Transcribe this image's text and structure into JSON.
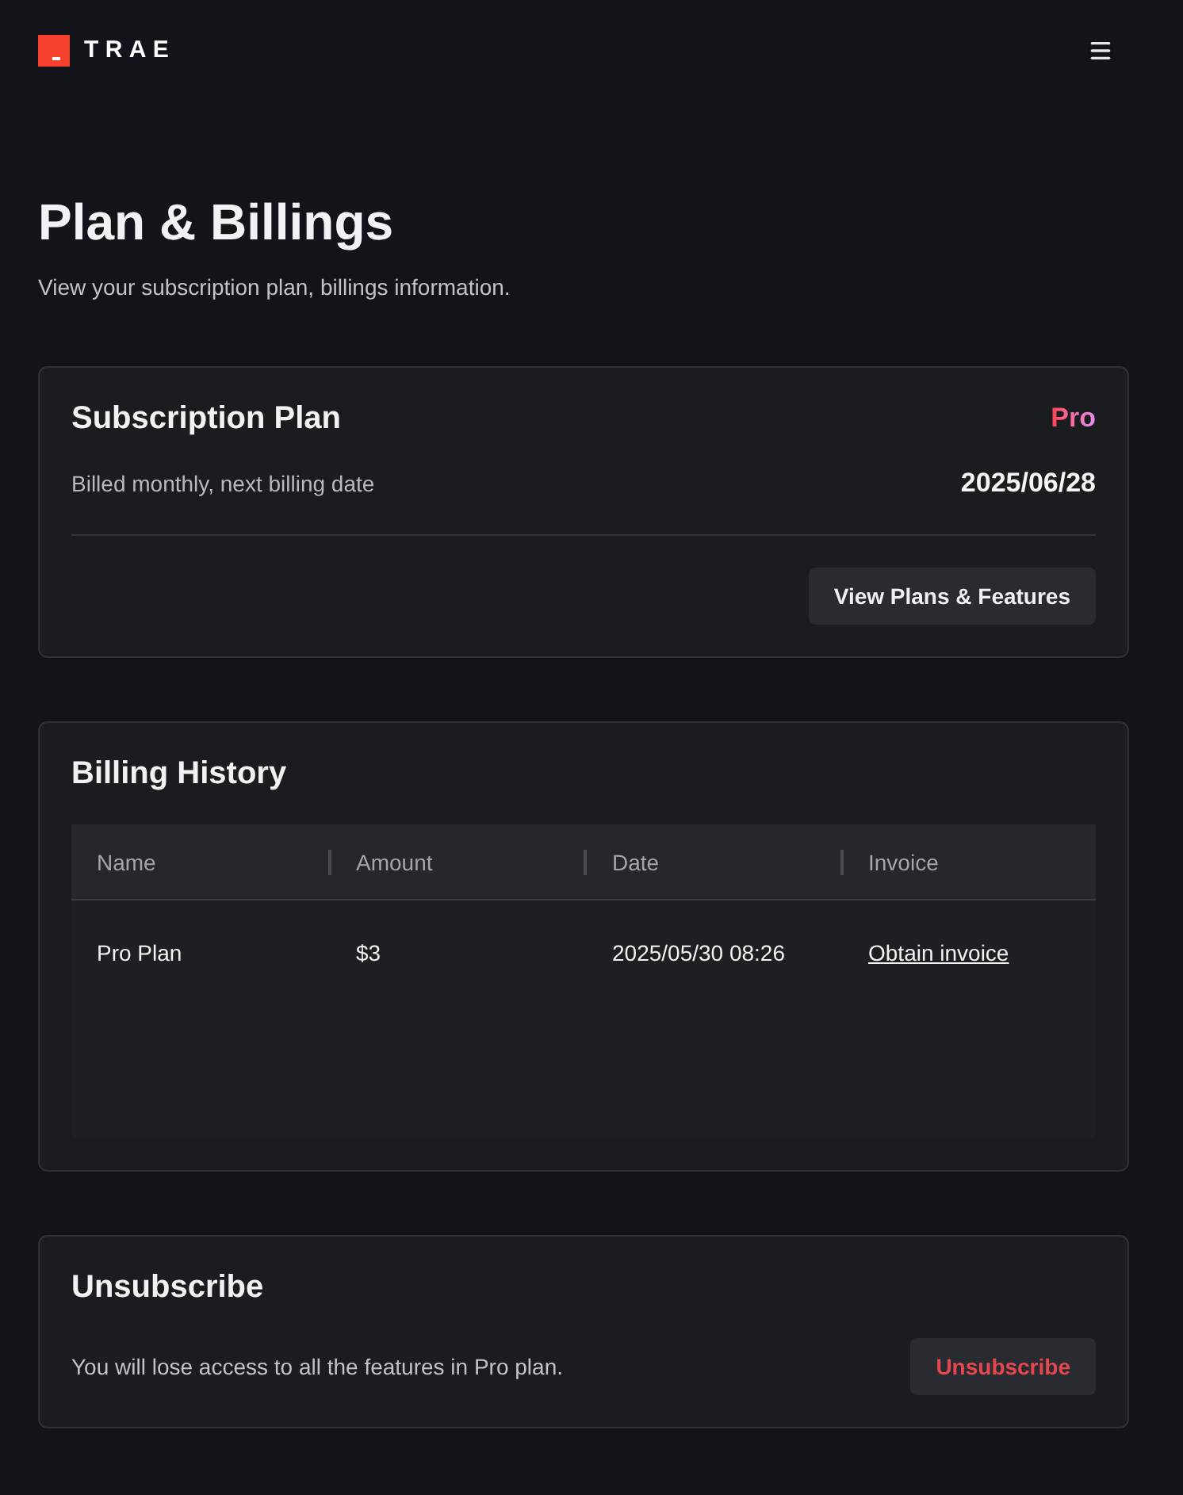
{
  "header": {
    "logo_text": "TRAE"
  },
  "page": {
    "title": "Plan & Billings",
    "subtitle": "View your subscription plan, billings information."
  },
  "subscription_plan": {
    "title": "Subscription Plan",
    "plan": "Pro",
    "billing_label": "Billed monthly, next billing date",
    "next_billing_date": "2025/06/28",
    "button": "View Plans & Features"
  },
  "billing_history": {
    "title": "Billing History",
    "columns": [
      "Name",
      "Amount",
      "Date",
      "Invoice"
    ],
    "rows": [
      {
        "name": "Pro Plan",
        "amount": "$3",
        "date": "2025/05/30 08:26",
        "invoice": "Obtain invoice"
      }
    ]
  },
  "unsubscribe": {
    "title": "Unsubscribe",
    "description": "You will lose access to all the features in Pro plan.",
    "button": "Unsubscribe"
  }
}
